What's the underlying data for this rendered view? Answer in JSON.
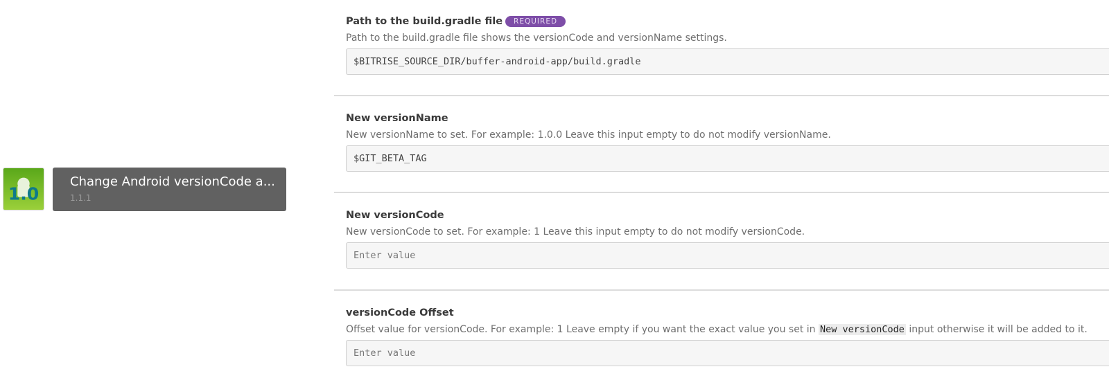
{
  "step": {
    "icon": "android-version-1.0-icon",
    "title": "Change Android versionCode a...",
    "version": "1.1.1"
  },
  "inputs": [
    {
      "label": "Path to the build.gradle file",
      "badge": "REQUIRED",
      "description": "Path to the build.gradle file shows the versionCode and versionName settings.",
      "value": "$BITRISE_SOURCE_DIR/buffer-android-app/build.gradle"
    },
    {
      "label": "New versionName",
      "description": "New versionName to set. For example: 1.0.0 Leave this input empty to do not modify versionName.",
      "value": "$GIT_BETA_TAG"
    },
    {
      "label": "New versionCode",
      "description": "New versionCode to set. For example: 1 Leave this input empty to do not modify versionCode.",
      "placeholder": "Enter value"
    },
    {
      "label": "versionCode Offset",
      "description_before": "Offset value for versionCode. For example: 1 Leave empty if you want the exact value you set in",
      "description_code": "New versionCode",
      "description_after": "input otherwise it will be added to it.",
      "placeholder": "Enter value"
    }
  ],
  "colors": {
    "badge": "#7e4ea8",
    "step_card": "#616161"
  }
}
